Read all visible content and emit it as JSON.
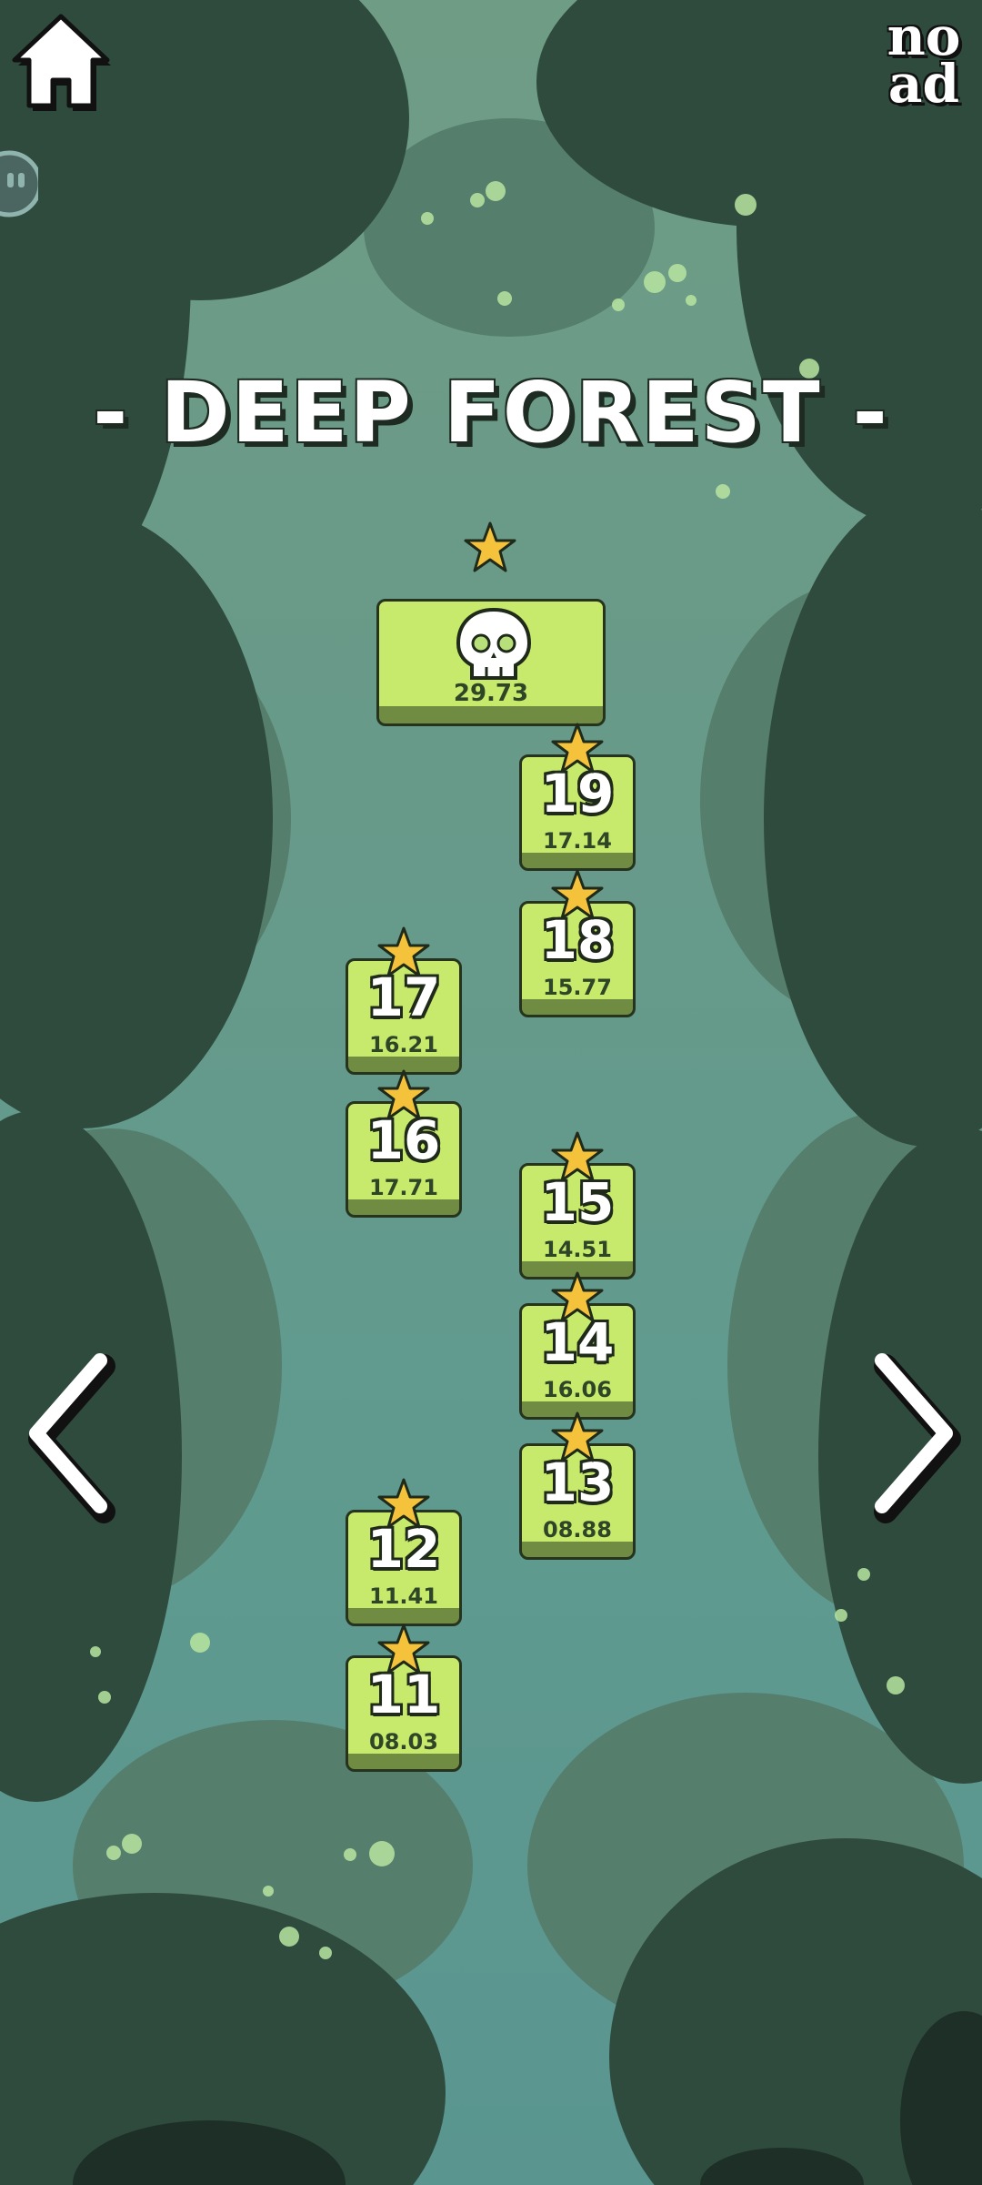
{
  "header": {
    "home_icon": "house-icon",
    "noad_line1": "no",
    "noad_line2": "ad"
  },
  "title": "- DEEP FOREST -",
  "boss": {
    "icon": "skull-icon",
    "time": "29.73",
    "stars": 1
  },
  "levels": [
    {
      "number": "19",
      "time": "17.14"
    },
    {
      "number": "18",
      "time": "15.77"
    },
    {
      "number": "17",
      "time": "16.21"
    },
    {
      "number": "16",
      "time": "17.71"
    },
    {
      "number": "15",
      "time": "14.51"
    },
    {
      "number": "14",
      "time": "16.06"
    },
    {
      "number": "13",
      "time": "08.88"
    },
    {
      "number": "12",
      "time": "11.41"
    },
    {
      "number": "11",
      "time": "08.03"
    }
  ],
  "nav": {
    "prev_icon": "chevron-left-icon",
    "next_icon": "chevron-right-icon"
  },
  "colors": {
    "tile": "#c8ea6c",
    "tile_shadow": "#6f8c42",
    "star": "#f5c33b",
    "foliage_dark": "#2f4b3e",
    "foliage_mid": "#4b6e5b",
    "background": "#659a8b"
  }
}
